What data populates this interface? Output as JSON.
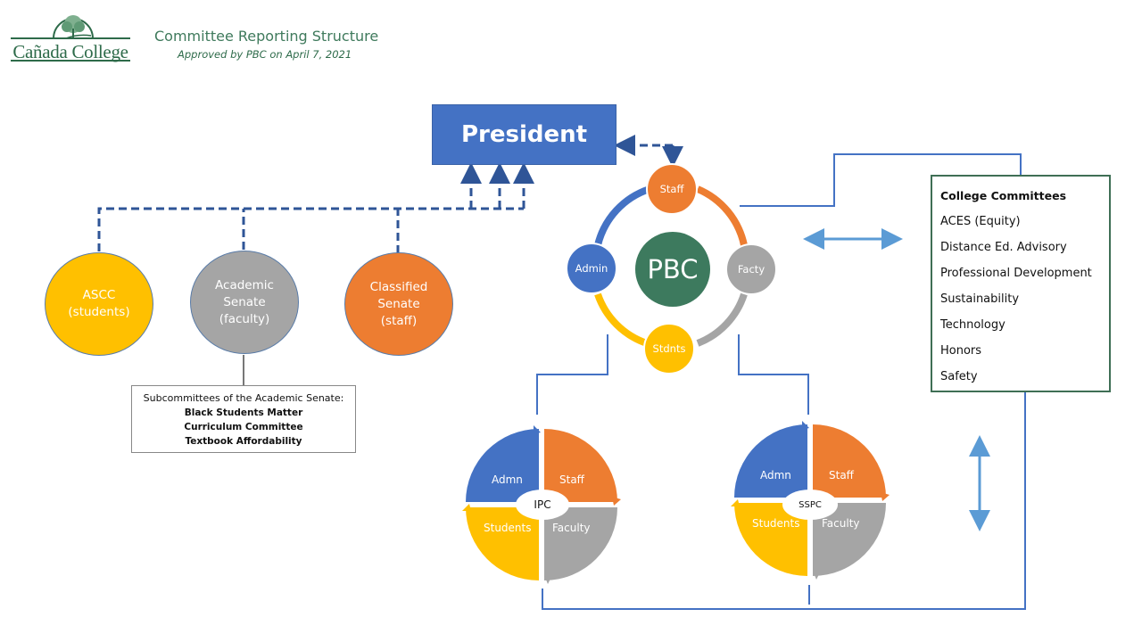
{
  "header": {
    "logo_text": "Cañada College",
    "title": "Committee Reporting Structure",
    "subtitle": "Approved by PBC on April 7, 2021"
  },
  "president": {
    "label": "President"
  },
  "senates": [
    {
      "line1": "ASCC",
      "line2": "(students)",
      "line3": "",
      "color": "#ffc000"
    },
    {
      "line1": "Academic",
      "line2": "Senate",
      "line3": "(faculty)",
      "color": "#a5a5a5"
    },
    {
      "line1": "Classified",
      "line2": "Senate",
      "line3": "(staff)",
      "color": "#ed7d31"
    }
  ],
  "subcommittees": {
    "heading": "Subcommittees of the Academic Senate:",
    "items": [
      "Black Students Matter",
      "Curriculum Committee",
      "Textbook Affordability"
    ]
  },
  "pbc": {
    "center": "PBC",
    "nodes": [
      {
        "label": "Staff",
        "color": "#ed7d31"
      },
      {
        "label": "Facty",
        "color": "#a5a5a5"
      },
      {
        "label": "Stdnts",
        "color": "#ffc000"
      },
      {
        "label": "Admin",
        "color": "#4472c4"
      }
    ]
  },
  "college_committees": {
    "heading": "College Committees",
    "items": [
      "ACES (Equity)",
      "Distance Ed. Advisory",
      "Professional Development",
      "Sustainability",
      "Technology",
      "Honors",
      "Safety"
    ]
  },
  "cycles": [
    {
      "center": "IPC",
      "quadrants": [
        "Admn",
        "Staff",
        "Students",
        "Faculty"
      ]
    },
    {
      "center": "SSPC",
      "quadrants": [
        "Admn",
        "Staff",
        "Students",
        "Faculty"
      ]
    }
  ],
  "colors": {
    "blue": "#4472c4",
    "orange": "#ed7d31",
    "gray": "#a5a5a5",
    "gold": "#ffc000",
    "green": "#3d7a5e",
    "dash_blue": "#2f5597",
    "arrow_light_blue": "#5b9bd5"
  }
}
